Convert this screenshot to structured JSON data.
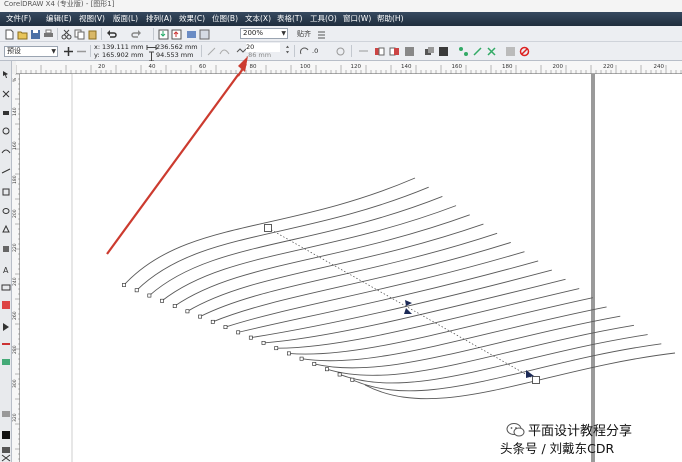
{
  "window": {
    "title": "CorelDRAW X4 (专业版) - [图形1]"
  },
  "menubar": {
    "items": [
      {
        "label": "文件(F)"
      },
      {
        "label": "编辑(E)"
      },
      {
        "label": "视图(V)"
      },
      {
        "label": "版面(L)"
      },
      {
        "label": "排列(A)"
      },
      {
        "label": "效果(C)"
      },
      {
        "label": "位图(B)"
      },
      {
        "label": "文本(X)"
      },
      {
        "label": "表格(T)"
      },
      {
        "label": "工具(O)"
      },
      {
        "label": "窗口(W)"
      },
      {
        "label": "帮助(H)"
      }
    ]
  },
  "toolbar": {
    "zoom_value": "200%",
    "snap_label": "贴齐",
    "preset_value": "预设"
  },
  "property_bar": {
    "x_label": "x:",
    "x_value": "139.111 mm",
    "y_label": "y:",
    "y_value": "165.902 mm",
    "width_value": "236.562 mm",
    "height_value": "94.553 mm",
    "steps_value": "20",
    "spacing_value": ".86 mm",
    "angle_value": ".0"
  },
  "rulers": {
    "top_labels": [
      "20",
      "40",
      "60",
      "80",
      "100",
      "120",
      "140",
      "160",
      "180",
      "200",
      "220",
      "240"
    ],
    "left_labels": [
      "%",
      "140",
      "160",
      "180",
      "200",
      "220",
      "240",
      "260",
      "280",
      "300",
      "320"
    ]
  },
  "canvas": {
    "blend_lines": 20,
    "colors": {
      "line": "#5a5a5a",
      "arrow": "#cc3b2f",
      "page_edge": "#9a9a9a"
    }
  },
  "watermark": {
    "title": "平面设计教程分享",
    "subtitle": "头条号 / 刘戴东CDR"
  }
}
